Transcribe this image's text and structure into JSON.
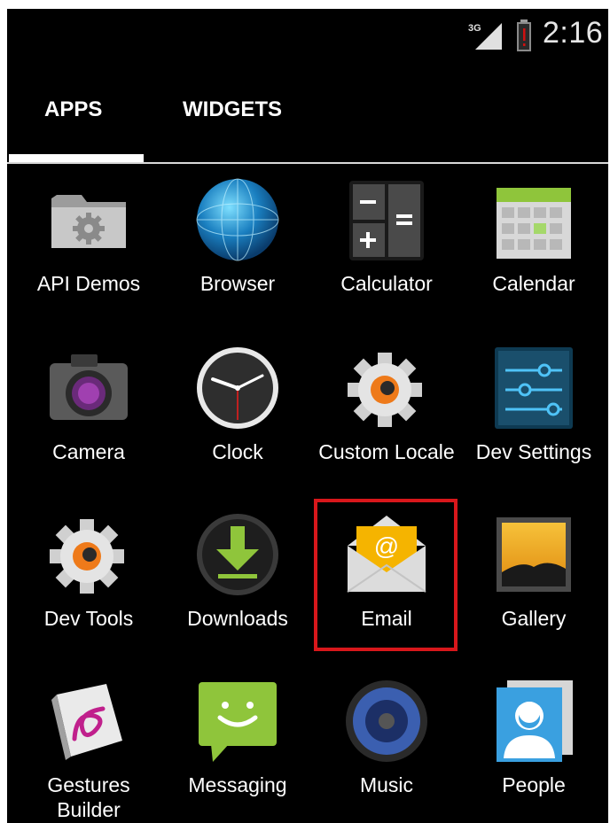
{
  "status_bar": {
    "network": "3G",
    "time": "2:16"
  },
  "tabs": [
    {
      "label": "APPS",
      "active": true
    },
    {
      "label": "WIDGETS",
      "active": false
    }
  ],
  "apps": [
    {
      "label": "API Demos",
      "icon": "folder-gear-icon"
    },
    {
      "label": "Browser",
      "icon": "globe-icon"
    },
    {
      "label": "Calculator",
      "icon": "calculator-icon"
    },
    {
      "label": "Calendar",
      "icon": "calendar-icon"
    },
    {
      "label": "Camera",
      "icon": "camera-icon"
    },
    {
      "label": "Clock",
      "icon": "clock-icon"
    },
    {
      "label": "Custom Locale",
      "icon": "gear-icon"
    },
    {
      "label": "Dev Settings",
      "icon": "sliders-icon"
    },
    {
      "label": "Dev Tools",
      "icon": "gear-icon"
    },
    {
      "label": "Downloads",
      "icon": "download-icon"
    },
    {
      "label": "Email",
      "icon": "envelope-icon",
      "highlighted": true
    },
    {
      "label": "Gallery",
      "icon": "picture-icon"
    },
    {
      "label": "Gestures Builder",
      "icon": "gesture-icon"
    },
    {
      "label": "Messaging",
      "icon": "speech-bubble-icon"
    },
    {
      "label": "Music",
      "icon": "speaker-icon"
    },
    {
      "label": "People",
      "icon": "contact-card-icon"
    }
  ],
  "colors": {
    "highlight": "#d8171b",
    "background": "#000000"
  }
}
